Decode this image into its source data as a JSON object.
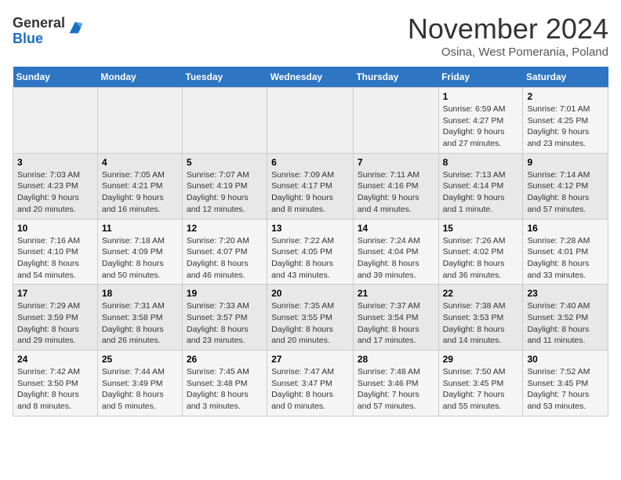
{
  "logo": {
    "general": "General",
    "blue": "Blue"
  },
  "title": "November 2024",
  "location": "Osina, West Pomerania, Poland",
  "days_of_week": [
    "Sunday",
    "Monday",
    "Tuesday",
    "Wednesday",
    "Thursday",
    "Friday",
    "Saturday"
  ],
  "weeks": [
    [
      {
        "day": "",
        "info": ""
      },
      {
        "day": "",
        "info": ""
      },
      {
        "day": "",
        "info": ""
      },
      {
        "day": "",
        "info": ""
      },
      {
        "day": "",
        "info": ""
      },
      {
        "day": "1",
        "info": "Sunrise: 6:59 AM\nSunset: 4:27 PM\nDaylight: 9 hours and 27 minutes."
      },
      {
        "day": "2",
        "info": "Sunrise: 7:01 AM\nSunset: 4:25 PM\nDaylight: 9 hours and 23 minutes."
      }
    ],
    [
      {
        "day": "3",
        "info": "Sunrise: 7:03 AM\nSunset: 4:23 PM\nDaylight: 9 hours and 20 minutes."
      },
      {
        "day": "4",
        "info": "Sunrise: 7:05 AM\nSunset: 4:21 PM\nDaylight: 9 hours and 16 minutes."
      },
      {
        "day": "5",
        "info": "Sunrise: 7:07 AM\nSunset: 4:19 PM\nDaylight: 9 hours and 12 minutes."
      },
      {
        "day": "6",
        "info": "Sunrise: 7:09 AM\nSunset: 4:17 PM\nDaylight: 9 hours and 8 minutes."
      },
      {
        "day": "7",
        "info": "Sunrise: 7:11 AM\nSunset: 4:16 PM\nDaylight: 9 hours and 4 minutes."
      },
      {
        "day": "8",
        "info": "Sunrise: 7:13 AM\nSunset: 4:14 PM\nDaylight: 9 hours and 1 minute."
      },
      {
        "day": "9",
        "info": "Sunrise: 7:14 AM\nSunset: 4:12 PM\nDaylight: 8 hours and 57 minutes."
      }
    ],
    [
      {
        "day": "10",
        "info": "Sunrise: 7:16 AM\nSunset: 4:10 PM\nDaylight: 8 hours and 54 minutes."
      },
      {
        "day": "11",
        "info": "Sunrise: 7:18 AM\nSunset: 4:09 PM\nDaylight: 8 hours and 50 minutes."
      },
      {
        "day": "12",
        "info": "Sunrise: 7:20 AM\nSunset: 4:07 PM\nDaylight: 8 hours and 46 minutes."
      },
      {
        "day": "13",
        "info": "Sunrise: 7:22 AM\nSunset: 4:05 PM\nDaylight: 8 hours and 43 minutes."
      },
      {
        "day": "14",
        "info": "Sunrise: 7:24 AM\nSunset: 4:04 PM\nDaylight: 8 hours and 39 minutes."
      },
      {
        "day": "15",
        "info": "Sunrise: 7:26 AM\nSunset: 4:02 PM\nDaylight: 8 hours and 36 minutes."
      },
      {
        "day": "16",
        "info": "Sunrise: 7:28 AM\nSunset: 4:01 PM\nDaylight: 8 hours and 33 minutes."
      }
    ],
    [
      {
        "day": "17",
        "info": "Sunrise: 7:29 AM\nSunset: 3:59 PM\nDaylight: 8 hours and 29 minutes."
      },
      {
        "day": "18",
        "info": "Sunrise: 7:31 AM\nSunset: 3:58 PM\nDaylight: 8 hours and 26 minutes."
      },
      {
        "day": "19",
        "info": "Sunrise: 7:33 AM\nSunset: 3:57 PM\nDaylight: 8 hours and 23 minutes."
      },
      {
        "day": "20",
        "info": "Sunrise: 7:35 AM\nSunset: 3:55 PM\nDaylight: 8 hours and 20 minutes."
      },
      {
        "day": "21",
        "info": "Sunrise: 7:37 AM\nSunset: 3:54 PM\nDaylight: 8 hours and 17 minutes."
      },
      {
        "day": "22",
        "info": "Sunrise: 7:38 AM\nSunset: 3:53 PM\nDaylight: 8 hours and 14 minutes."
      },
      {
        "day": "23",
        "info": "Sunrise: 7:40 AM\nSunset: 3:52 PM\nDaylight: 8 hours and 11 minutes."
      }
    ],
    [
      {
        "day": "24",
        "info": "Sunrise: 7:42 AM\nSunset: 3:50 PM\nDaylight: 8 hours and 8 minutes."
      },
      {
        "day": "25",
        "info": "Sunrise: 7:44 AM\nSunset: 3:49 PM\nDaylight: 8 hours and 5 minutes."
      },
      {
        "day": "26",
        "info": "Sunrise: 7:45 AM\nSunset: 3:48 PM\nDaylight: 8 hours and 3 minutes."
      },
      {
        "day": "27",
        "info": "Sunrise: 7:47 AM\nSunset: 3:47 PM\nDaylight: 8 hours and 0 minutes."
      },
      {
        "day": "28",
        "info": "Sunrise: 7:48 AM\nSunset: 3:46 PM\nDaylight: 7 hours and 57 minutes."
      },
      {
        "day": "29",
        "info": "Sunrise: 7:50 AM\nSunset: 3:45 PM\nDaylight: 7 hours and 55 minutes."
      },
      {
        "day": "30",
        "info": "Sunrise: 7:52 AM\nSunset: 3:45 PM\nDaylight: 7 hours and 53 minutes."
      }
    ]
  ]
}
